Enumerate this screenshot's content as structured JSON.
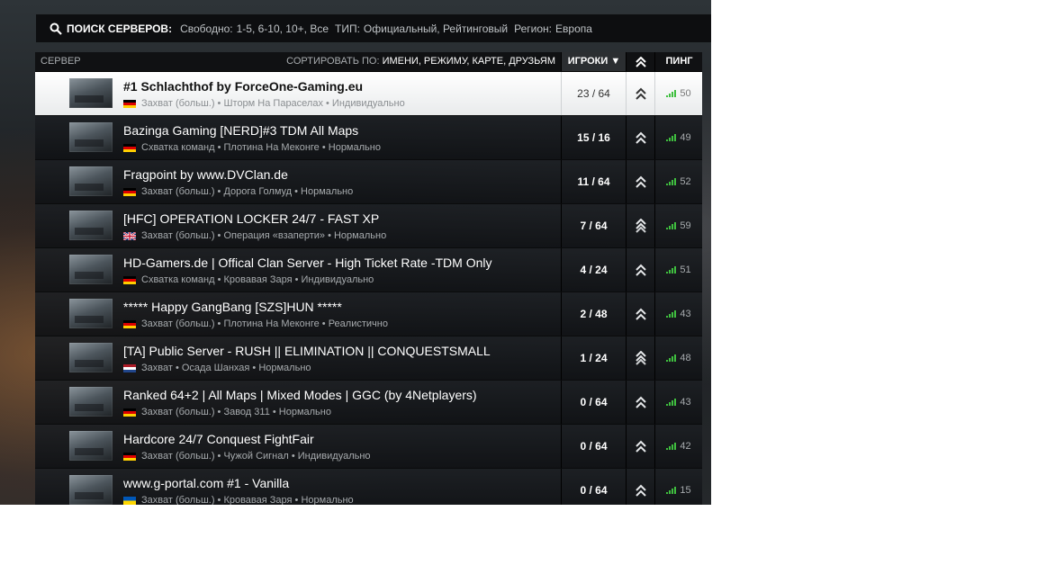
{
  "search": {
    "title": "ПОИСК СЕРВЕРОВ:",
    "free_label": "Свободно:",
    "free_value": "1-5, 6-10, 10+, Все",
    "type_label": "ТИП:",
    "type_value": "Официальный, Рейтинговый",
    "region_label": "Регион:",
    "region_value": "Европа"
  },
  "columns": {
    "server": "СЕРВЕР",
    "sort_label": "СОРТИРОВАТЬ ПО:",
    "sort_options": "ИМЕНИ, РЕЖИМУ, КАРТЕ, ДРУЗЬЯМ",
    "players": "ИГРОКИ ▼",
    "rank_icon": "rank-chevron-icon",
    "ping": "ПИНГ"
  },
  "colors": {
    "ping_bars": "#3fbf3f",
    "selected_row": "#ffffff"
  },
  "servers": [
    {
      "name": "#1 Schlachthof by ForceOne-Gaming.eu",
      "info": "Захват (больш.) • Шторм На Параселах • Индивидуально",
      "players": "23 / 64",
      "ping": "50",
      "flag": "de",
      "rank": "double-chevron",
      "selected": true
    },
    {
      "name": "Bazinga Gaming [NERD]#3 TDM All Maps",
      "info": "Схватка команд • Плотина На Меконге • Нормально",
      "players": "15 / 16",
      "ping": "49",
      "flag": "de",
      "rank": "double-chevron"
    },
    {
      "name": "Fragpoint by www.DVClan.de",
      "info": "Захват (больш.) • Дорога Голмуд • Нормально",
      "players": "11 / 64",
      "ping": "52",
      "flag": "de",
      "rank": "double-chevron"
    },
    {
      "name": "[HFC] OPERATION LOCKER 24/7 - FAST XP",
      "info": "Захват (больш.) • Операция «взаперти» • Нормально",
      "players": "7 / 64",
      "ping": "59",
      "flag": "uk",
      "rank": "triple-chevron"
    },
    {
      "name": "HD-Gamers.de | Offical Clan Server - High Ticket Rate -TDM Only",
      "info": "Схватка команд • Кровавая Заря • Индивидуально",
      "players": "4 / 24",
      "ping": "51",
      "flag": "de",
      "rank": "double-chevron"
    },
    {
      "name": "***** Happy GangBang [SZS]HUN *****",
      "info": "Захват (больш.) • Плотина На Меконге • Реалистично",
      "players": "2 / 48",
      "ping": "43",
      "flag": "de",
      "rank": "double-chevron"
    },
    {
      "name": "[TA] Public Server - RUSH || ELIMINATION || CONQUESTSMALL",
      "info": "Захват • Осада Шанхая • Нормально",
      "players": "1 / 24",
      "ping": "48",
      "flag": "nl",
      "rank": "triple-chevron"
    },
    {
      "name": "Ranked 64+2 | All Maps | Mixed Modes | GGC (by 4Netplayers)",
      "info": "Захват (больш.) • Завод 311 • Нормально",
      "players": "0 / 64",
      "ping": "43",
      "flag": "de",
      "rank": "double-chevron"
    },
    {
      "name": "Hardcore 24/7 Conquest FightFair",
      "info": "Захват (больш.) • Чужой Сигнал • Индивидуально",
      "players": "0 / 64",
      "ping": "42",
      "flag": "de",
      "rank": "double-chevron"
    },
    {
      "name": "www.g-portal.com #1 - Vanilla",
      "info": "Захват (больш.) • Кровавая Заря • Нормально",
      "players": "0 / 64",
      "ping": "15",
      "flag": "ua",
      "rank": "double-chevron"
    }
  ]
}
